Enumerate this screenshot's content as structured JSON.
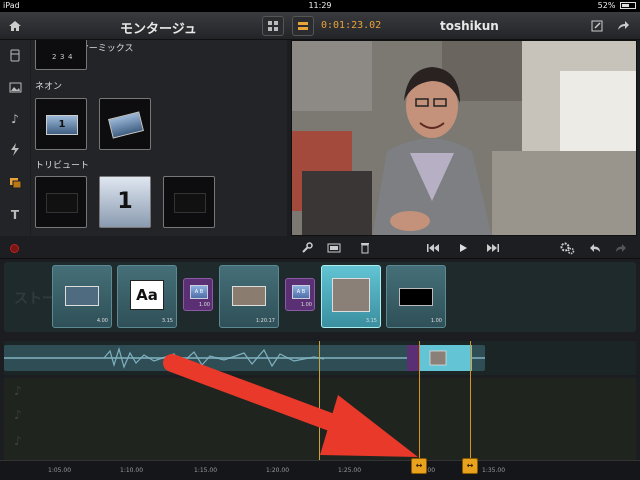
{
  "status_bar": {
    "device": "iPad",
    "time": "11:29",
    "battery": "52%"
  },
  "toolbar": {
    "title": "モンタージュ",
    "timecode": "0:01:23.02",
    "project_name": "toshikun",
    "grid_icon": "grid-icon",
    "filmstrip_icon": "filmstrip-icon",
    "export_icon": "export-icon",
    "edit_icon": "edit-icon",
    "home_icon": "home-icon"
  },
  "sidebar": {
    "items": [
      {
        "icon": "media-library-icon"
      },
      {
        "icon": "photo-icon"
      },
      {
        "icon": "music-note-icon"
      },
      {
        "icon": "effects-bolt-icon"
      },
      {
        "icon": "transitions-icon",
        "active": true
      },
      {
        "icon": "title-text-icon"
      }
    ]
  },
  "library": {
    "sections": [
      {
        "label": "マルチレイヤーミックス"
      },
      {
        "label": "ネオン"
      },
      {
        "label": "トリビュート"
      }
    ],
    "thumb_numbers": [
      "1",
      "2",
      "3",
      "4"
    ]
  },
  "transport": {
    "tools": [
      "wrench-icon",
      "clip-split-icon",
      "trash-icon"
    ],
    "controls": [
      "skip-back-icon",
      "play-icon",
      "skip-forward-icon"
    ],
    "right": [
      "settings-gears-icon",
      "undo-icon",
      "redo-icon"
    ]
  },
  "story_track": {
    "watermark": "ストー",
    "clips": [
      {
        "kind": "video",
        "duration": "4.00"
      },
      {
        "kind": "title",
        "title_text": "Aa",
        "duration": "3.15"
      },
      {
        "kind": "transition",
        "label": "A B",
        "duration": "1.00"
      },
      {
        "kind": "video",
        "duration": "1:20.17"
      },
      {
        "kind": "transition",
        "label": "A B",
        "duration": "1.00"
      },
      {
        "kind": "video",
        "duration": "3.15",
        "selected": true
      },
      {
        "kind": "blank",
        "duration": "1.00"
      }
    ]
  },
  "ruler": {
    "ticks": [
      "1:05.00",
      "1:10.00",
      "1:15.00",
      "1:20.00",
      "1:25.00",
      "1:30.00",
      "1:35.00"
    ]
  },
  "annotation": {
    "arrow_color": "#e8392a"
  },
  "colors": {
    "accent": "#e8a33a",
    "selected_clip": "#62c4d4",
    "transition": "#5a2f74"
  }
}
